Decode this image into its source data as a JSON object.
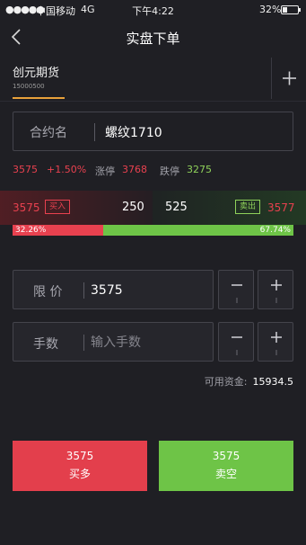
{
  "status_bar": {
    "signal": "●●●●●",
    "carrier": "中国移动",
    "network": "4G",
    "time": "下午4:22",
    "battery": "32%",
    "battery_level": 0.32
  },
  "nav": {
    "back_icon": "chevron-left-icon",
    "title": "实盘下单"
  },
  "account": {
    "name": "创元期货",
    "number": "15000500",
    "add_icon": "plus-icon"
  },
  "contract": {
    "label": "合约名",
    "value": "螺纹1710"
  },
  "quote": {
    "last_price": "3575",
    "change_pct": "+1.50%",
    "limit_up_label": "涨停",
    "limit_up": "3768",
    "limit_down_label": "跌停",
    "limit_down": "3275"
  },
  "order_book": {
    "bid_price": "3575",
    "bid_tag": "买入",
    "bid_volume": "250",
    "ask_volume": "525",
    "ask_tag": "卖出",
    "ask_price": "3577",
    "bid_pct_text": "32.26%",
    "ask_pct_text": "67.74%",
    "bid_fraction": 0.3226
  },
  "price_field": {
    "label": "限 价",
    "value": "3575"
  },
  "qty_field": {
    "label": "手数",
    "placeholder": "输入手数",
    "value": ""
  },
  "funds": {
    "label": "可用资金:",
    "value": "15934.5"
  },
  "buy_button": {
    "price": "3575",
    "label": "买多"
  },
  "sell_button": {
    "price": "3575",
    "label": "卖空"
  },
  "colors": {
    "background": "#1f1f24",
    "up_red": "#e8414f",
    "down_green": "#6ec447",
    "accent": "#e8a13a"
  }
}
